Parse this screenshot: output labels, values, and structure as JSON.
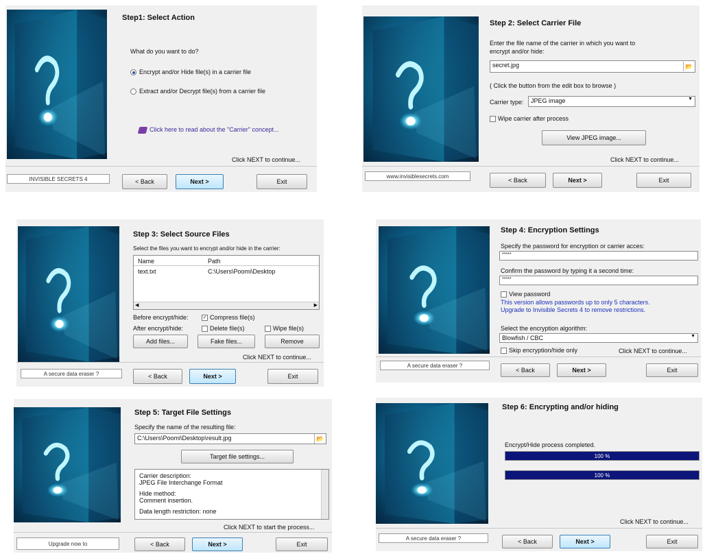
{
  "common": {
    "back_label": "< Back",
    "next_label": "Next >",
    "exit_label": "Exit"
  },
  "step1": {
    "title": "Step1: Select Action",
    "question": "What do you want to do?",
    "option1": "Encrypt and/or Hide file(s) in a carrier file",
    "option2": "Extract and/or Decrypt file(s) from a carrier file",
    "link": "Click here to read about the \"Carrier\" concept...",
    "hint": "Click NEXT to continue...",
    "footer": "INVISIBLE SECRETS 4"
  },
  "step2": {
    "title": "Step 2: Select Carrier File",
    "instruction_line1": "Enter the file name of the carrier in which you want to",
    "instruction_line2": "encrypt and/or hide:",
    "file_value": "secret.jpg",
    "browse_hint": "( Click the button from the edit box to browse )",
    "carrier_type_label": "Carrier type:",
    "carrier_type_value": "JPEG image",
    "wipe_label": "Wipe carrier after process",
    "view_button": "View JPEG image...",
    "hint": "Click NEXT to continue...",
    "footer": "www.invisiblesecrets.com"
  },
  "step3": {
    "title": "Step 3: Select Source Files",
    "instruction": "Select the files you want to encrypt and/or hide in the carrier:",
    "col_name": "Name",
    "col_path": "Path",
    "rows": [
      {
        "name": "text.txt",
        "path": "C:\\Users\\Poomi\\Desktop"
      }
    ],
    "before_label": "Before encrypt/hide:",
    "compress_label": "Compress file(s)",
    "after_label": "After encrypt/hide:",
    "delete_label": "Delete file(s)",
    "wipe_label": "Wipe file(s)",
    "add_button": "Add files...",
    "fake_button": "Fake files...",
    "remove_button": "Remove",
    "hint": "Click NEXT to continue...",
    "footer": "A secure data eraser ?"
  },
  "step4": {
    "title": "Step 4: Encryption Settings",
    "password_label": "Specify the password for encryption or carrier acces:",
    "password_value": "*****",
    "confirm_label": "Confirm the password by typing it a second time:",
    "confirm_value": "*****",
    "view_password_label": "View password",
    "notice_line1": "This version allows passwords up to only 5 characters.",
    "notice_line2": "Upgrade to Invisible Secrets 4 to remove restrictions.",
    "algo_label": "Select the encryption algorithm:",
    "algo_value": "Blowfish / CBC",
    "skip_label": "Skip encryption/hide only",
    "hint": "Click NEXT to continue...",
    "footer": "A secure data eraser ?"
  },
  "step5": {
    "title": "Step 5: Target File Settings",
    "instruction": "Specify the name of the resulting file:",
    "file_value": "C:\\Users\\Poomi\\Desktop\\result.jpg",
    "target_button": "Target file settings...",
    "desc_lines": [
      "Carrier description:",
      "JPEG File Interchange Format",
      "",
      "Hide method:",
      "Comment insertion.",
      "",
      "Data length restriction: none"
    ],
    "hint": "Click NEXT to start the process...",
    "footer": "Upgrade now to"
  },
  "step6": {
    "title": "Step 6: Encrypting and/or hiding",
    "status": "Encrypt/Hide process completed.",
    "progress1_label": "100 %",
    "progress1_value": 1.0,
    "progress2_label": "100 %",
    "progress2_value": 1.0,
    "hint": "Click NEXT to continue...",
    "footer": "A secure data eraser ?"
  }
}
